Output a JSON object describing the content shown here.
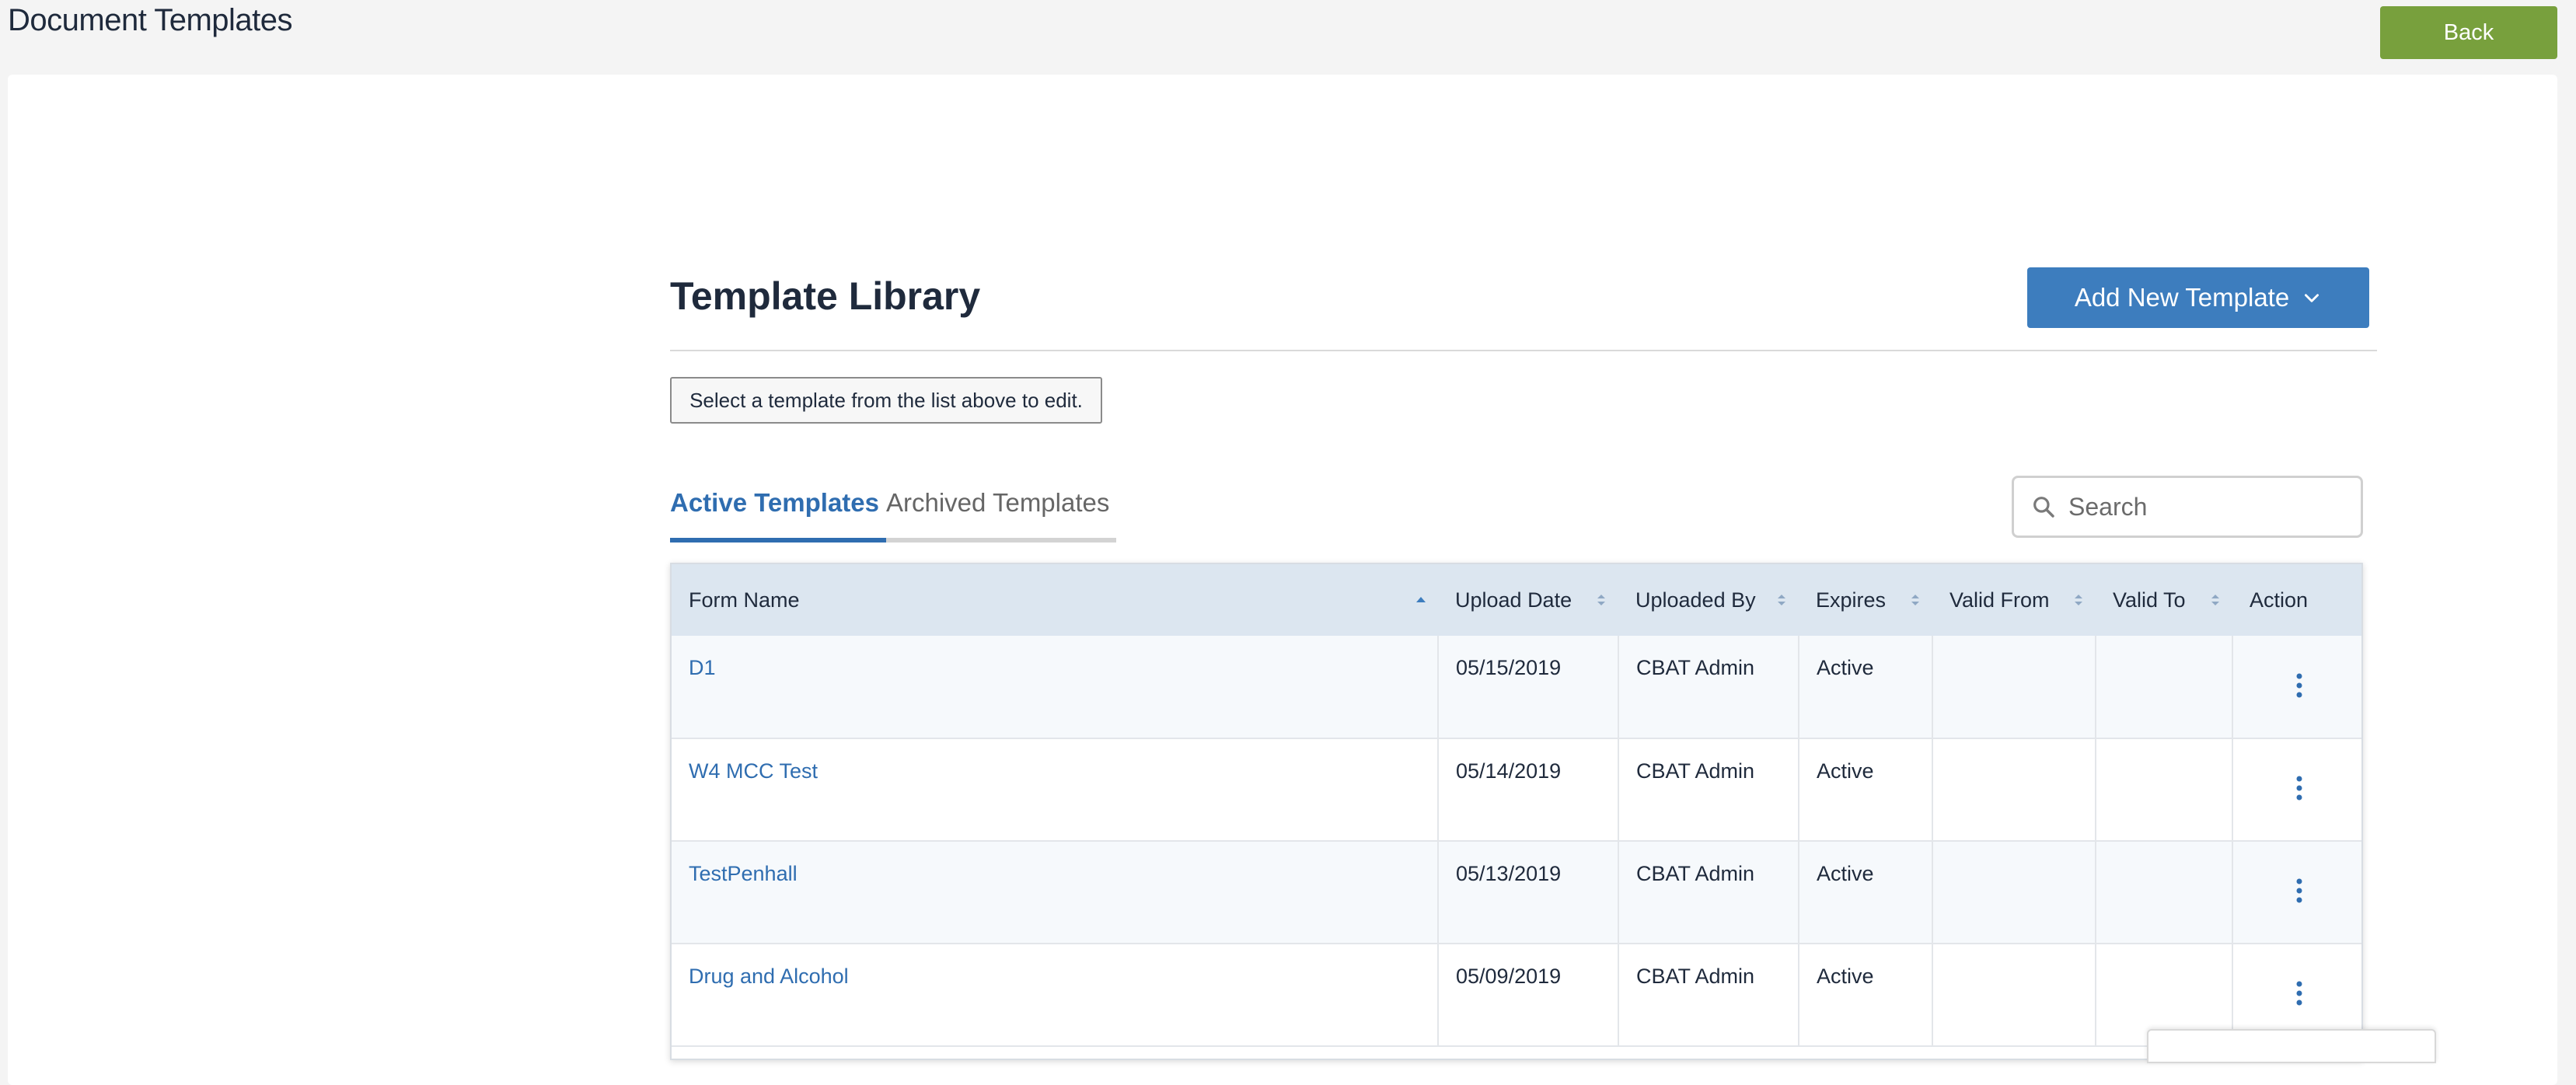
{
  "header": {
    "title": "Document Templates",
    "back_label": "Back"
  },
  "library": {
    "title": "Template Library",
    "add_button_label": "Add New Template",
    "hint": "Select a template from the list above to edit."
  },
  "tabs": [
    {
      "label": "Active Templates",
      "active": true
    },
    {
      "label": "Archived Templates",
      "active": false
    }
  ],
  "search": {
    "placeholder": "Search",
    "value": ""
  },
  "table": {
    "columns": [
      "Form Name",
      "Upload Date",
      "Uploaded By",
      "Expires",
      "Valid From",
      "Valid To",
      "Action"
    ],
    "rows": [
      {
        "form_name": "D1",
        "upload_date": "05/15/2019",
        "uploaded_by": "CBAT Admin",
        "expires": "Active",
        "valid_from": "",
        "valid_to": ""
      },
      {
        "form_name": "W4 MCC Test",
        "upload_date": "05/14/2019",
        "uploaded_by": "CBAT Admin",
        "expires": "Active",
        "valid_from": "",
        "valid_to": ""
      },
      {
        "form_name": "TestPenhall",
        "upload_date": "05/13/2019",
        "uploaded_by": "CBAT Admin",
        "expires": "Active",
        "valid_from": "",
        "valid_to": ""
      },
      {
        "form_name": "Drug and Alcohol",
        "upload_date": "05/09/2019",
        "uploaded_by": "CBAT Admin",
        "expires": "Active",
        "valid_from": "",
        "valid_to": ""
      }
    ]
  },
  "colors": {
    "primary": "#3d7dbe",
    "link": "#2f6db0",
    "back": "#78a03d",
    "header_bg": "#dce6f0"
  },
  "icons": {
    "search": "search-icon",
    "chevron": "chevron-down-icon",
    "sort": "sort-icon",
    "kebab": "kebab-menu-icon"
  }
}
